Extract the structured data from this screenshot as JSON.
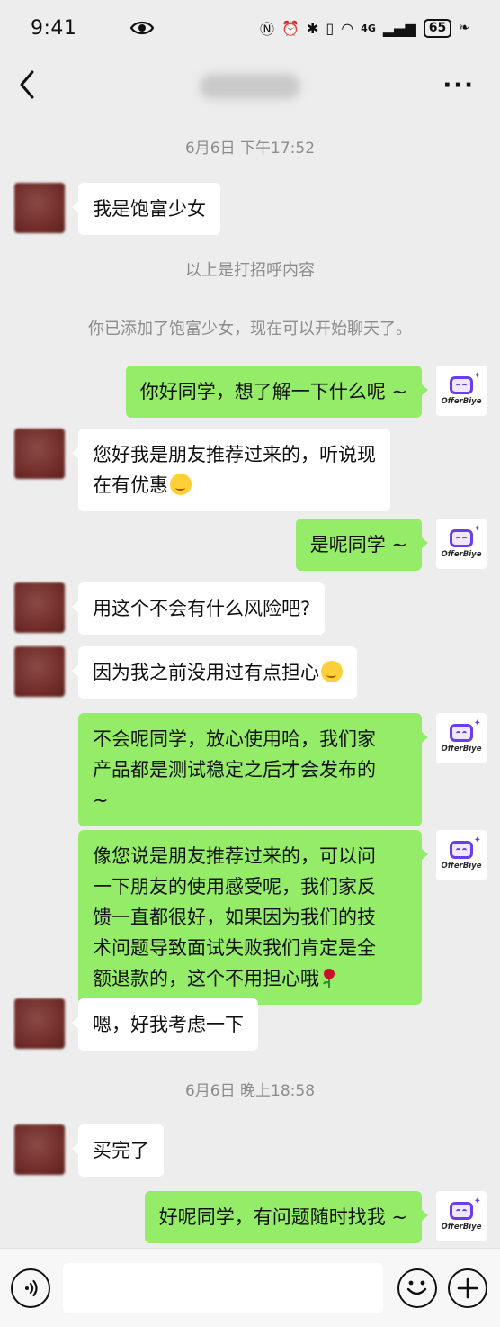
{
  "status_bar": {
    "time": "9:41",
    "battery": "65",
    "signal": "4G"
  },
  "header": {
    "title": "",
    "more": "···"
  },
  "messages": {
    "t1": "6月6日 下午17:52",
    "m1": "我是饱富少女",
    "sys1": "以上是打招呼内容",
    "sys2": "你已添加了饱富少女，现在可以开始聊天了。",
    "m2": "你好同学，想了解一下什么呢 ~",
    "m3_l1": "您好我是朋友推荐过来的，听说现",
    "m3_l2": "在有优惠",
    "m4": "是呢同学 ~",
    "m5": "用这个不会有什么风险吧?",
    "m6": "因为我之前没用过有点担心",
    "m7_l1": "不会呢同学，放心使用哈，我们家",
    "m7_l2": "产品都是测试稳定之后才会发布的",
    "m7_l3": "~",
    "m8_l1": "像您说是朋友推荐过来的，可以问",
    "m8_l2": "一下朋友的使用感受呢，我们家反",
    "m8_l3": "馈一直都很好，如果因为我们的技",
    "m8_l4": "术问题导致面试失败我们肯定是全",
    "m8_l5": "额退款的，这个不用担心哦",
    "m9": "嗯，好我考虑一下",
    "t2": "6月6日 晚上18:58",
    "m10": "买完了",
    "m11": "好呢同学，有问题随时找我 ~"
  },
  "brand": {
    "logo_text": "OfferBiye",
    "accent": "#6b3df0",
    "bubble_out": "#95ec69",
    "bubble_in": "#ffffff"
  },
  "input": {
    "placeholder": ""
  }
}
